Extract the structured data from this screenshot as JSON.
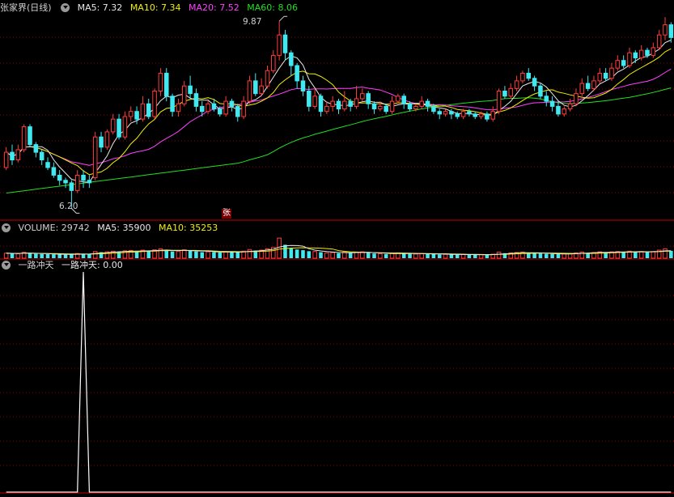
{
  "header": {
    "title": "张家界(日线)",
    "ma5": "MA5: 7.32",
    "ma10": "MA10: 7.34",
    "ma20": "MA20: 7.52",
    "ma60": "MA60: 8.06"
  },
  "volume_header": {
    "title": "VOLUME: 29742",
    "ma5": "MA5: 35900",
    "ma10": "MA10: 35253"
  },
  "indicator_header": {
    "name": "一路冲天",
    "value": "一路冲天: 0.00"
  },
  "annotations": {
    "high": "9.87",
    "low": "6.20",
    "zhang_badge": "张"
  },
  "colors": {
    "up": "#ff3c3c",
    "down": "#40e8f0",
    "ma5": "#e8e8e8",
    "ma10": "#f0f000",
    "ma20": "#ff40ff",
    "ma60": "#20e020",
    "grid": "#8b0000",
    "border": "#c00000",
    "indicator": "#ffffff"
  },
  "chart_data": {
    "type": "candlestick",
    "price_range": [
      6.0,
      10.0
    ],
    "high": 9.87,
    "low": 6.2,
    "candles": [
      [
        7.0,
        7.3,
        7.4,
        6.95
      ],
      [
        7.3,
        7.15,
        7.45,
        7.05
      ],
      [
        7.15,
        7.35,
        7.45,
        7.1
      ],
      [
        7.35,
        7.8,
        7.85,
        7.3
      ],
      [
        7.8,
        7.45,
        7.85,
        7.4
      ],
      [
        7.45,
        7.3,
        7.5,
        7.2
      ],
      [
        7.3,
        7.15,
        7.35,
        7.05
      ],
      [
        7.1,
        7.0,
        7.2,
        6.95
      ],
      [
        7.0,
        6.85,
        7.1,
        6.8
      ],
      [
        6.85,
        6.75,
        6.95,
        6.65
      ],
      [
        6.75,
        6.7,
        6.8,
        6.6
      ],
      [
        6.7,
        6.55,
        6.75,
        6.2
      ],
      [
        6.55,
        6.85,
        6.95,
        6.5
      ],
      [
        6.85,
        6.75,
        6.95,
        6.6
      ],
      [
        6.75,
        6.7,
        6.85,
        6.6
      ],
      [
        6.8,
        7.6,
        7.7,
        6.75
      ],
      [
        7.6,
        7.4,
        7.7,
        7.3
      ],
      [
        7.4,
        7.7,
        7.75,
        7.35
      ],
      [
        7.7,
        7.95,
        8.05,
        7.65
      ],
      [
        7.95,
        7.6,
        8.05,
        7.55
      ],
      [
        7.6,
        8.0,
        8.1,
        7.55
      ],
      [
        8.0,
        8.1,
        8.2,
        7.9
      ],
      [
        8.1,
        7.95,
        8.2,
        7.85
      ],
      [
        7.95,
        8.25,
        8.4,
        7.9
      ],
      [
        8.25,
        8.0,
        8.35,
        7.95
      ],
      [
        8.0,
        8.5,
        8.55,
        7.95
      ],
      [
        8.5,
        8.85,
        8.95,
        8.4
      ],
      [
        8.85,
        8.4,
        8.95,
        8.3
      ],
      [
        8.4,
        8.1,
        8.45,
        8.0
      ],
      [
        8.1,
        8.25,
        8.35,
        8.0
      ],
      [
        8.25,
        8.6,
        8.7,
        8.2
      ],
      [
        8.6,
        8.45,
        8.8,
        8.35
      ],
      [
        8.45,
        8.2,
        8.55,
        8.1
      ],
      [
        8.2,
        8.1,
        8.3,
        8.0
      ],
      [
        8.1,
        8.25,
        8.3,
        8.05
      ],
      [
        8.25,
        8.15,
        8.35,
        8.1
      ],
      [
        8.15,
        8.05,
        8.2,
        8.0
      ],
      [
        8.05,
        8.3,
        8.4,
        8.0
      ],
      [
        8.3,
        8.2,
        8.35,
        8.1
      ],
      [
        8.2,
        8.0,
        8.25,
        7.9
      ],
      [
        8.0,
        8.3,
        8.4,
        7.95
      ],
      [
        8.3,
        8.7,
        8.8,
        8.25
      ],
      [
        8.7,
        8.45,
        8.85,
        8.4
      ],
      [
        8.45,
        8.6,
        8.75,
        8.4
      ],
      [
        8.6,
        8.9,
        9.0,
        8.55
      ],
      [
        8.9,
        9.2,
        9.3,
        8.85
      ],
      [
        9.2,
        9.6,
        9.87,
        9.1
      ],
      [
        9.6,
        9.25,
        9.7,
        9.1
      ],
      [
        9.25,
        9.0,
        9.3,
        8.8
      ],
      [
        9.0,
        8.7,
        9.05,
        8.55
      ],
      [
        8.7,
        8.5,
        8.8,
        8.4
      ],
      [
        8.5,
        8.2,
        8.6,
        8.1
      ],
      [
        8.2,
        8.4,
        8.55,
        8.15
      ],
      [
        8.4,
        8.1,
        8.45,
        8.0
      ],
      [
        8.1,
        8.2,
        8.3,
        8.05
      ],
      [
        8.2,
        8.3,
        8.4,
        8.1
      ],
      [
        8.3,
        8.15,
        8.35,
        8.05
      ],
      [
        8.15,
        8.3,
        8.5,
        8.1
      ],
      [
        8.3,
        8.2,
        8.35,
        8.1
      ],
      [
        8.2,
        8.35,
        8.6,
        8.15
      ],
      [
        8.35,
        8.45,
        8.55,
        8.3
      ],
      [
        8.45,
        8.25,
        8.5,
        8.15
      ],
      [
        8.25,
        8.15,
        8.3,
        8.05
      ],
      [
        8.15,
        8.2,
        8.3,
        8.1
      ],
      [
        8.2,
        8.1,
        8.25,
        8.05
      ],
      [
        8.1,
        8.3,
        8.4,
        8.05
      ],
      [
        8.3,
        8.4,
        8.45,
        8.25
      ],
      [
        8.4,
        8.25,
        8.45,
        8.15
      ],
      [
        8.25,
        8.15,
        8.3,
        8.1
      ],
      [
        8.15,
        8.2,
        8.25,
        8.1
      ],
      [
        8.2,
        8.3,
        8.4,
        8.15
      ],
      [
        8.3,
        8.2,
        8.35,
        8.1
      ],
      [
        8.2,
        8.1,
        8.25,
        8.05
      ],
      [
        8.1,
        8.05,
        8.15,
        7.95
      ],
      [
        8.05,
        8.1,
        8.15,
        8.0
      ],
      [
        8.1,
        8.05,
        8.15,
        7.95
      ],
      [
        8.05,
        8.0,
        8.1,
        7.95
      ],
      [
        8.0,
        8.1,
        8.15,
        7.95
      ],
      [
        8.1,
        8.05,
        8.15,
        8.0
      ],
      [
        8.05,
        8.0,
        8.1,
        7.95
      ],
      [
        8.0,
        8.05,
        8.1,
        7.95
      ],
      [
        8.05,
        7.95,
        8.1,
        7.9
      ],
      [
        7.95,
        8.1,
        8.2,
        7.9
      ],
      [
        8.1,
        8.5,
        8.55,
        8.05
      ],
      [
        8.5,
        8.4,
        8.6,
        8.35
      ],
      [
        8.4,
        8.55,
        8.65,
        8.35
      ],
      [
        8.55,
        8.7,
        8.8,
        8.5
      ],
      [
        8.7,
        8.85,
        8.9,
        8.65
      ],
      [
        8.85,
        8.75,
        8.95,
        8.7
      ],
      [
        8.75,
        8.6,
        8.8,
        8.5
      ],
      [
        8.6,
        8.4,
        8.65,
        8.35
      ],
      [
        8.4,
        8.3,
        8.5,
        8.2
      ],
      [
        8.3,
        8.2,
        8.4,
        8.1
      ],
      [
        8.2,
        8.05,
        8.3,
        8.0
      ],
      [
        8.05,
        8.15,
        8.2,
        8.0
      ],
      [
        8.15,
        8.25,
        8.35,
        8.1
      ],
      [
        8.25,
        8.45,
        8.55,
        8.2
      ],
      [
        8.45,
        8.65,
        8.75,
        8.4
      ],
      [
        8.65,
        8.55,
        8.8,
        8.5
      ],
      [
        8.55,
        8.7,
        8.8,
        8.5
      ],
      [
        8.7,
        8.85,
        8.95,
        8.65
      ],
      [
        8.85,
        8.75,
        8.95,
        8.7
      ],
      [
        8.75,
        8.95,
        9.05,
        8.7
      ],
      [
        8.95,
        9.1,
        9.2,
        8.9
      ],
      [
        9.1,
        9.0,
        9.2,
        8.95
      ],
      [
        9.0,
        9.25,
        9.35,
        8.95
      ],
      [
        9.25,
        9.15,
        9.3,
        9.05
      ],
      [
        9.15,
        9.3,
        9.4,
        9.1
      ],
      [
        9.3,
        9.2,
        9.35,
        9.15
      ],
      [
        9.2,
        9.35,
        9.45,
        9.15
      ],
      [
        9.35,
        9.6,
        9.7,
        9.3
      ],
      [
        9.6,
        9.8,
        9.95,
        9.5
      ],
      [
        9.8,
        9.55,
        9.85,
        9.45
      ]
    ],
    "volume_range": [
      0,
      140000
    ],
    "volumes": [
      30000,
      28000,
      27000,
      35000,
      30000,
      26000,
      25000,
      24000,
      23000,
      22000,
      21000,
      24000,
      28000,
      26000,
      25000,
      40000,
      36000,
      38000,
      42000,
      38000,
      44000,
      46000,
      40000,
      48000,
      42000,
      50000,
      56000,
      48000,
      40000,
      42000,
      50000,
      46000,
      40000,
      36000,
      38000,
      36000,
      34000,
      40000,
      38000,
      34000,
      42000,
      52000,
      46000,
      48000,
      56000,
      64000,
      120000,
      80000,
      60000,
      52000,
      48000,
      42000,
      40000,
      36000,
      32000,
      34000,
      30000,
      36000,
      32000,
      36000,
      38000,
      32000,
      28000,
      26000,
      25000,
      30000,
      32000,
      28000,
      26000,
      25000,
      28000,
      26000,
      24000,
      22000,
      23000,
      22000,
      21000,
      22000,
      21000,
      20000,
      21000,
      20000,
      24000,
      36000,
      30000,
      32000,
      34000,
      36000,
      32000,
      30000,
      28000,
      26000,
      25000,
      24000,
      26000,
      28000,
      32000,
      36000,
      32000,
      34000,
      38000,
      34000,
      38000,
      40000,
      36000,
      42000,
      38000,
      40000,
      36000,
      40000,
      48000,
      56000,
      44000
    ],
    "indicator": {
      "name": "一路冲天",
      "range": [
        0,
        1
      ],
      "spike_index": 13,
      "value": 0.0
    }
  }
}
